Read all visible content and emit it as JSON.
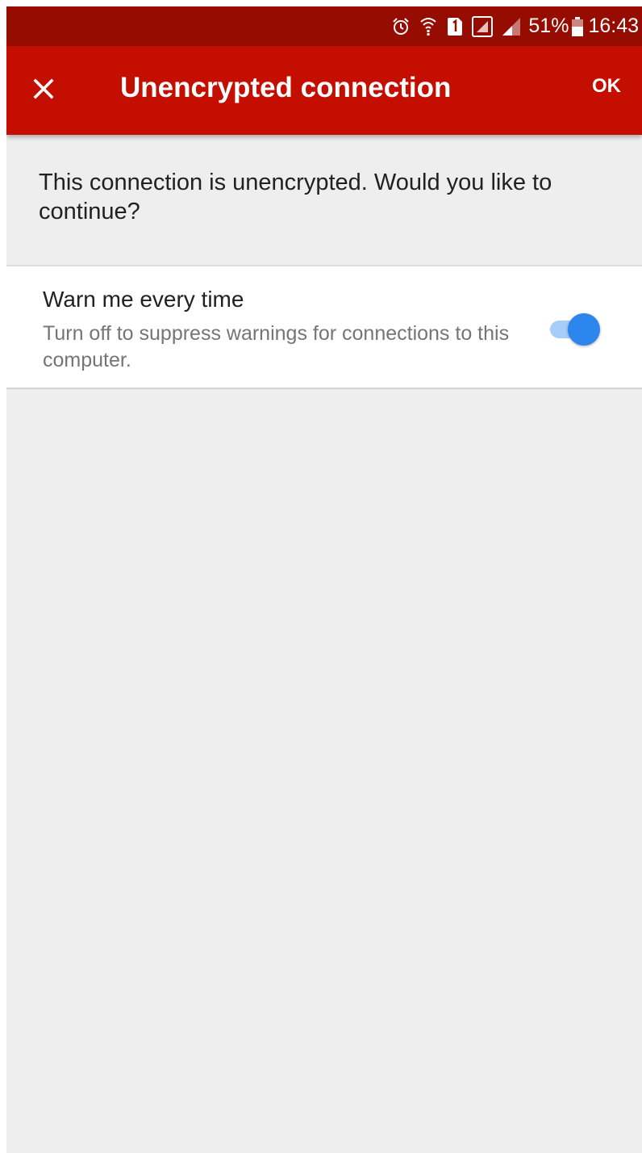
{
  "status_bar": {
    "icons": [
      "alarm-icon",
      "wifi-calling-icon",
      "sim-1-icon",
      "signal-icon",
      "signal-icon"
    ],
    "battery_percent": "51%",
    "time": "16:43"
  },
  "app_bar": {
    "close_icon": "close-icon",
    "title": "Unencrypted connection",
    "ok_label": "OK",
    "color": "#c30e00"
  },
  "message": "This connection is unencrypted. Would you like to continue?",
  "setting": {
    "title": "Warn me every time",
    "description": "Turn off to suppress warnings for connections to this computer.",
    "enabled": true,
    "accent_color": "#2c86ee"
  }
}
